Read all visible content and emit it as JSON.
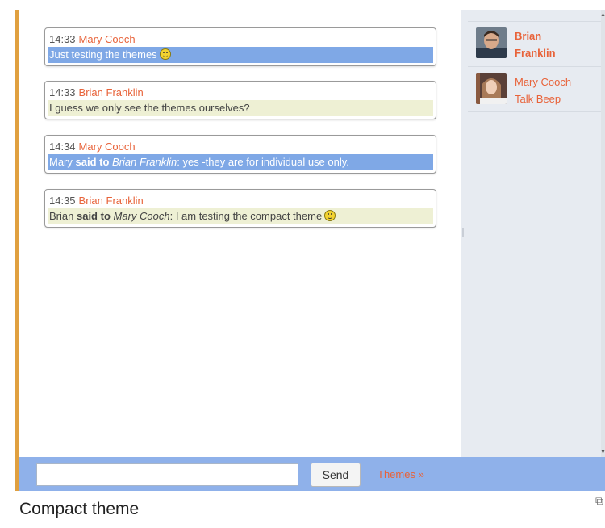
{
  "messages": [
    {
      "time": "14:33",
      "author": "Mary Cooch",
      "style": "own",
      "prefix": "",
      "said_to": "",
      "target": "",
      "text": "Just testing the themes",
      "smiley": true
    },
    {
      "time": "14:33",
      "author": "Brian Franklin",
      "style": "other",
      "prefix": "",
      "said_to": "",
      "target": "",
      "text": "I guess we only see the themes ourselves?",
      "smiley": false
    },
    {
      "time": "14:34",
      "author": "Mary Cooch",
      "style": "own",
      "prefix": "Mary",
      "said_to": "said to",
      "target": "Brian Franklin",
      "text": ": yes -they are for individual use only.",
      "smiley": false
    },
    {
      "time": "14:35",
      "author": "Brian Franklin",
      "style": "other",
      "prefix": "Brian",
      "said_to": "said to",
      "target": "Mary Cooch",
      "text": ": I am testing the compact theme",
      "smiley": true
    }
  ],
  "users": [
    {
      "line1": "Brian",
      "line2": "Franklin",
      "bold": true,
      "avatar": "male-avatar"
    },
    {
      "line1": "Mary Cooch",
      "line2": "Talk Beep",
      "bold": false,
      "avatar": "female-avatar"
    }
  ],
  "input": {
    "value": "",
    "placeholder": ""
  },
  "send_label": "Send",
  "themes_link": "Themes »",
  "caption": "Compact theme",
  "colors": {
    "accent_border": "#e0a040",
    "own_bg": "#7fa8e6",
    "other_bg": "#eef0d4",
    "name": "#e8633a",
    "input_bar": "#8fb1ea"
  }
}
